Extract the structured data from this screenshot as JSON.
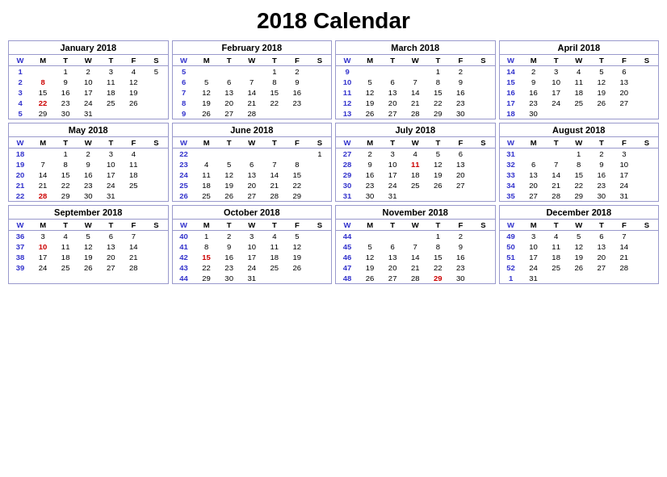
{
  "title": "2018 Calendar",
  "months": [
    {
      "name": "January 2018",
      "headers": [
        "W",
        "M",
        "T",
        "W",
        "T",
        "F",
        "S"
      ],
      "weeks": [
        [
          "1",
          "",
          "1",
          "2",
          "3",
          "4",
          "5"
        ],
        [
          "2",
          "8",
          "9",
          "10",
          "11",
          "12",
          ""
        ],
        [
          "3",
          "15",
          "16",
          "17",
          "18",
          "19",
          ""
        ],
        [
          "4",
          "22",
          "23",
          "24",
          "25",
          "26",
          ""
        ],
        [
          "5",
          "29",
          "30",
          "31",
          "",
          "",
          ""
        ]
      ],
      "redCells": {
        "1-1": "1",
        "3-1": "15"
      }
    },
    {
      "name": "February 2018",
      "headers": [
        "W",
        "M",
        "T",
        "W",
        "T",
        "F",
        "S"
      ],
      "weeks": [
        [
          "5",
          "",
          "",
          "",
          "1",
          "2",
          ""
        ],
        [
          "6",
          "5",
          "6",
          "7",
          "8",
          "9",
          ""
        ],
        [
          "7",
          "12",
          "13",
          "14",
          "15",
          "16",
          ""
        ],
        [
          "8",
          "19",
          "20",
          "21",
          "22",
          "23",
          ""
        ],
        [
          "9",
          "26",
          "27",
          "28",
          "",
          "",
          ""
        ]
      ],
      "redCells": {}
    },
    {
      "name": "March 2018",
      "headers": [
        "W",
        "M",
        "T",
        "W",
        "T",
        "F",
        "S"
      ],
      "weeks": [
        [
          "9",
          "",
          "",
          "",
          "1",
          "2",
          ""
        ],
        [
          "10",
          "5",
          "6",
          "7",
          "8",
          "9",
          ""
        ],
        [
          "11",
          "12",
          "13",
          "14",
          "15",
          "16",
          ""
        ],
        [
          "12",
          "19",
          "20",
          "21",
          "22",
          "23",
          ""
        ],
        [
          "13",
          "26",
          "27",
          "28",
          "29",
          "30",
          ""
        ]
      ],
      "redCells": {}
    },
    {
      "name": "April 2018",
      "headers": [
        "W",
        "M",
        "T",
        "W",
        "T",
        "F",
        "S"
      ],
      "weeks": [
        [
          "14",
          "2",
          "3",
          "4",
          "5",
          "6",
          ""
        ],
        [
          "15",
          "9",
          "10",
          "11",
          "12",
          "13",
          ""
        ],
        [
          "16",
          "16",
          "17",
          "18",
          "19",
          "20",
          ""
        ],
        [
          "17",
          "23",
          "24",
          "25",
          "26",
          "27",
          ""
        ],
        [
          "18",
          "30",
          "",
          "",
          "",
          "",
          ""
        ]
      ],
      "redCells": {}
    },
    {
      "name": "May 2018",
      "headers": [
        "W",
        "M",
        "T",
        "W",
        "T",
        "F",
        "S"
      ],
      "weeks": [
        [
          "18",
          "",
          "1",
          "2",
          "3",
          "4",
          ""
        ],
        [
          "19",
          "7",
          "8",
          "9",
          "10",
          "11",
          ""
        ],
        [
          "20",
          "14",
          "15",
          "16",
          "17",
          "18",
          ""
        ],
        [
          "21",
          "21",
          "22",
          "23",
          "24",
          "25",
          ""
        ],
        [
          "22",
          "28",
          "29",
          "30",
          "31",
          "",
          ""
        ]
      ],
      "redCells": {
        "4-1": "28"
      }
    },
    {
      "name": "June 2018",
      "headers": [
        "W",
        "M",
        "T",
        "W",
        "T",
        "F",
        "S"
      ],
      "weeks": [
        [
          "22",
          "",
          "",
          "",
          "",
          "",
          "1"
        ],
        [
          "23",
          "4",
          "5",
          "6",
          "7",
          "8",
          ""
        ],
        [
          "24",
          "11",
          "12",
          "13",
          "14",
          "15",
          ""
        ],
        [
          "25",
          "18",
          "19",
          "20",
          "21",
          "22",
          ""
        ],
        [
          "26",
          "25",
          "26",
          "27",
          "28",
          "29",
          ""
        ]
      ],
      "redCells": {}
    },
    {
      "name": "July 2018",
      "headers": [
        "W",
        "M",
        "T",
        "W",
        "T",
        "F",
        "S"
      ],
      "weeks": [
        [
          "27",
          "2",
          "3",
          "4",
          "5",
          "6",
          ""
        ],
        [
          "28",
          "9",
          "10",
          "11",
          "12",
          "13",
          ""
        ],
        [
          "29",
          "16",
          "17",
          "18",
          "19",
          "20",
          ""
        ],
        [
          "30",
          "23",
          "24",
          "25",
          "26",
          "27",
          ""
        ],
        [
          "31",
          "30",
          "31",
          "",
          "",
          "",
          ""
        ]
      ],
      "redCells": {
        "1-3": "4"
      }
    },
    {
      "name": "August 2018",
      "headers": [
        "W",
        "M",
        "T",
        "W",
        "T",
        "F",
        "S"
      ],
      "weeks": [
        [
          "31",
          "",
          "",
          "1",
          "2",
          "3",
          ""
        ],
        [
          "32",
          "6",
          "7",
          "8",
          "9",
          "10",
          ""
        ],
        [
          "33",
          "13",
          "14",
          "15",
          "16",
          "17",
          ""
        ],
        [
          "34",
          "20",
          "21",
          "22",
          "23",
          "24",
          ""
        ],
        [
          "35",
          "27",
          "28",
          "29",
          "30",
          "31",
          ""
        ]
      ],
      "redCells": {}
    },
    {
      "name": "September 2018",
      "headers": [
        "W",
        "M",
        "T",
        "W",
        "T",
        "F",
        "S"
      ],
      "weeks": [
        [
          "36",
          "3",
          "4",
          "5",
          "6",
          "7",
          ""
        ],
        [
          "37",
          "10",
          "11",
          "12",
          "13",
          "14",
          ""
        ],
        [
          "38",
          "17",
          "18",
          "19",
          "20",
          "21",
          ""
        ],
        [
          "39",
          "24",
          "25",
          "26",
          "27",
          "28",
          ""
        ]
      ],
      "redCells": {
        "1-1": "3"
      }
    },
    {
      "name": "October 2018",
      "headers": [
        "W",
        "M",
        "T",
        "W",
        "T",
        "F",
        "S"
      ],
      "weeks": [
        [
          "40",
          "1",
          "2",
          "3",
          "4",
          "5",
          ""
        ],
        [
          "41",
          "8",
          "9",
          "10",
          "11",
          "12",
          ""
        ],
        [
          "42",
          "15",
          "16",
          "17",
          "18",
          "19",
          ""
        ],
        [
          "43",
          "22",
          "23",
          "24",
          "25",
          "26",
          ""
        ],
        [
          "44",
          "29",
          "30",
          "31",
          "",
          "",
          ""
        ]
      ],
      "redCells": {
        "2-1": "8"
      }
    },
    {
      "name": "November 2018",
      "headers": [
        "W",
        "M",
        "T",
        "W",
        "T",
        "F",
        "S"
      ],
      "weeks": [
        [
          "44",
          "",
          "",
          "",
          "1",
          "2",
          ""
        ],
        [
          "45",
          "5",
          "6",
          "7",
          "8",
          "9",
          ""
        ],
        [
          "46",
          "12",
          "13",
          "14",
          "15",
          "16",
          ""
        ],
        [
          "47",
          "19",
          "20",
          "21",
          "22",
          "23",
          ""
        ],
        [
          "48",
          "26",
          "27",
          "28",
          "29",
          "30",
          ""
        ]
      ],
      "redCells": {
        "4-4": "22"
      }
    },
    {
      "name": "December 2018",
      "headers": [
        "W",
        "M",
        "T",
        "W",
        "T",
        "F",
        "S"
      ],
      "weeks": [
        [
          "49",
          "3",
          "4",
          "5",
          "6",
          "7",
          ""
        ],
        [
          "50",
          "10",
          "11",
          "12",
          "13",
          "14",
          ""
        ],
        [
          "51",
          "17",
          "18",
          "19",
          "20",
          "21",
          ""
        ],
        [
          "52",
          "24",
          "25",
          "26",
          "27",
          "28",
          ""
        ],
        [
          "1",
          "31",
          "",
          "",
          "",
          "",
          ""
        ]
      ],
      "redCells": {
        "4-2": "25"
      }
    }
  ]
}
